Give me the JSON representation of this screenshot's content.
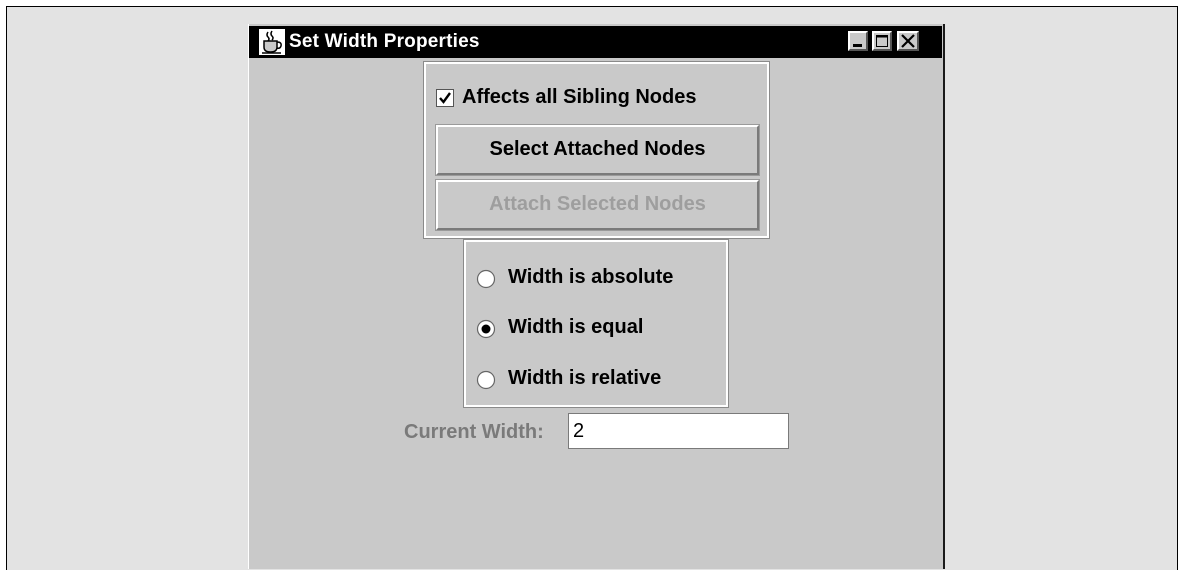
{
  "window": {
    "title": "Set Width Properties",
    "icon": "java-coffee-cup-icon",
    "controls": [
      "minimize-icon",
      "maximize-icon",
      "close-icon"
    ]
  },
  "options": {
    "affects_siblings_label": "Affects all Sibling Nodes",
    "affects_siblings_checked": true,
    "select_attached_label": "Select Attached Nodes",
    "attach_selected_label": "Attach Selected Nodes",
    "attach_selected_enabled": false
  },
  "width_mode": {
    "options": [
      {
        "label": "Width is absolute",
        "selected": false
      },
      {
        "label": "Width is equal",
        "selected": true
      },
      {
        "label": "Width is relative",
        "selected": false
      }
    ]
  },
  "current_width": {
    "label": "Current Width:",
    "value": "2"
  },
  "colors": {
    "window_bg": "#c9c9c9",
    "titlebar_bg": "#000000",
    "disabled_text": "#9e9e9e"
  }
}
